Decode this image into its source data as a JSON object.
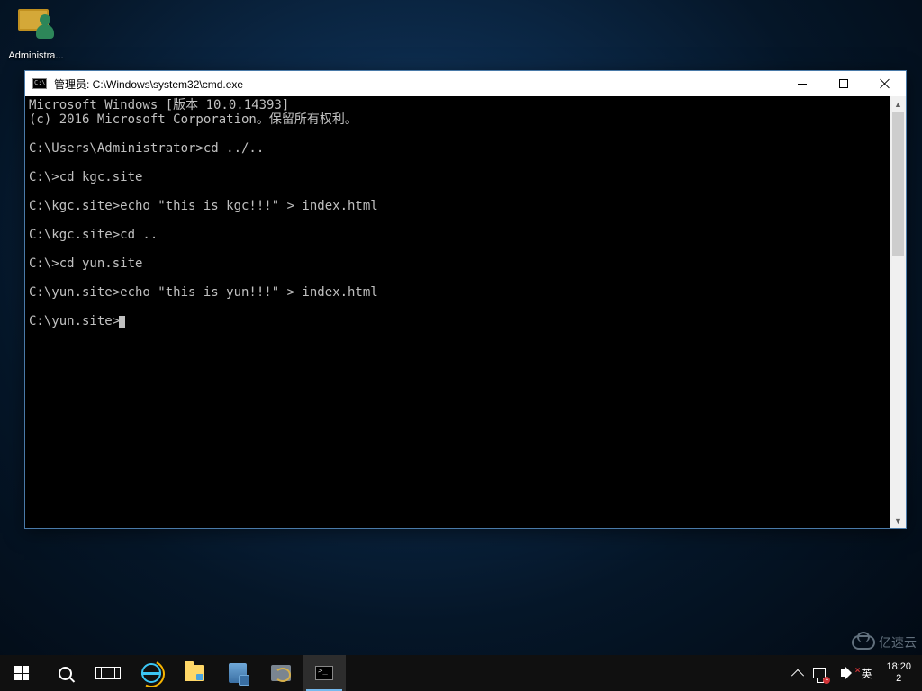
{
  "desktop": {
    "icons": [
      {
        "name": "administrator-icon",
        "label": "Administra..."
      }
    ]
  },
  "window": {
    "title": "管理员: C:\\Windows\\system32\\cmd.exe"
  },
  "terminal": {
    "lines": [
      "Microsoft Windows [版本 10.0.14393]",
      "(c) 2016 Microsoft Corporation。保留所有权利。",
      "",
      "C:\\Users\\Administrator>cd ../..",
      "",
      "C:\\>cd kgc.site",
      "",
      "C:\\kgc.site>echo \"this is kgc!!!\" > index.html",
      "",
      "C:\\kgc.site>cd ..",
      "",
      "C:\\>cd yun.site",
      "",
      "C:\\yun.site>echo \"this is yun!!!\" > index.html",
      "",
      "C:\\yun.site>"
    ]
  },
  "taskbar": {
    "items": [
      {
        "name": "start-button",
        "icon": "start-icon"
      },
      {
        "name": "search-button",
        "icon": "search-icon"
      },
      {
        "name": "taskview-button",
        "icon": "taskview-icon"
      },
      {
        "name": "ie-app",
        "icon": "ie-icon"
      },
      {
        "name": "file-explorer-app",
        "icon": "folder-icon"
      },
      {
        "name": "server-manager-app",
        "icon": "server-icon"
      },
      {
        "name": "disk-tool-app",
        "icon": "disk-icon"
      },
      {
        "name": "cmd-app",
        "icon": "cmd-icon",
        "active": true
      }
    ]
  },
  "tray": {
    "chevron": "˄",
    "network_status": "disconnected",
    "sound_status": "muted",
    "ime": "英",
    "time": "18:20",
    "date_partial": "2"
  },
  "watermark": {
    "text": "亿速云"
  }
}
